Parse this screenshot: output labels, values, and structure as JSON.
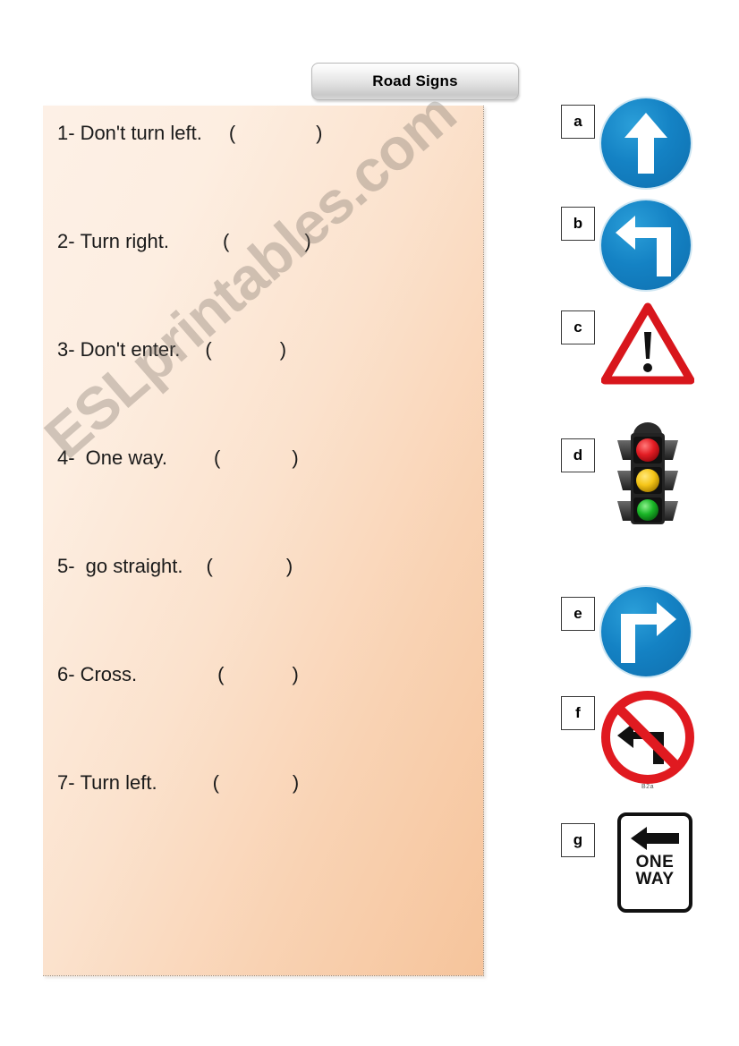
{
  "title": {
    "text": "Road Signs"
  },
  "watermark": {
    "text": "ESLprintables.com"
  },
  "worksheet": {
    "questions": [
      {
        "number": "1-",
        "text": "Don't turn left.",
        "open_paren": "(",
        "close_paren": ")",
        "answer": ""
      },
      {
        "number": "2-",
        "text": "Turn right.",
        "open_paren": "(",
        "close_paren": ")",
        "answer": ""
      },
      {
        "number": "3-",
        "text": "Don't enter.",
        "open_paren": "(",
        "close_paren": ")",
        "answer": ""
      },
      {
        "number": "4-",
        "text": " One way.",
        "open_paren": "(",
        "close_paren": ")",
        "answer": ""
      },
      {
        "number": "5-",
        "text": " go straight.",
        "open_paren": "(",
        "close_paren": ")",
        "answer": ""
      },
      {
        "number": "6-",
        "text": "Cross.",
        "open_paren": "(",
        "close_paren": ")",
        "answer": ""
      },
      {
        "number": "7-",
        "text": "Turn left.",
        "open_paren": "(",
        "close_paren": ")",
        "answer": ""
      }
    ]
  },
  "signs": [
    {
      "letter": "a",
      "icon": "go-straight-blue-sign",
      "caption": ""
    },
    {
      "letter": "b",
      "icon": "turn-left-blue-sign",
      "caption": ""
    },
    {
      "letter": "c",
      "icon": "warning-triangle-sign",
      "caption": ""
    },
    {
      "letter": "d",
      "icon": "traffic-light",
      "caption": ""
    },
    {
      "letter": "e",
      "icon": "turn-right-blue-sign",
      "caption": ""
    },
    {
      "letter": "f",
      "icon": "no-left-turn-sign",
      "caption": "B2a"
    },
    {
      "letter": "g",
      "icon": "one-way-plate",
      "line1": "ONE",
      "line2": "WAY",
      "caption": ""
    }
  ],
  "colors": {
    "sign_blue": "#1482c4",
    "sign_red": "#d8161c",
    "panel_peach": "#f9d3b4",
    "traffic_red": "#e31d24",
    "traffic_yellow": "#f5c518",
    "traffic_green": "#19b526"
  }
}
